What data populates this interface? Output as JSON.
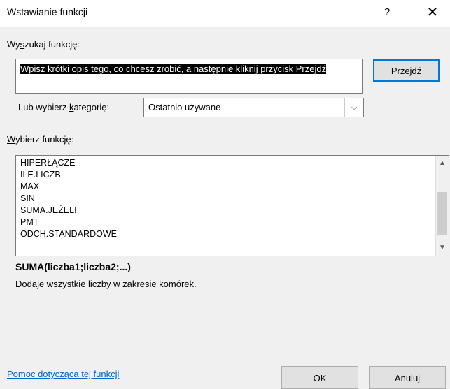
{
  "window": {
    "title": "Wstawianie funkcji",
    "help_glyph": "?",
    "close_glyph": "✕"
  },
  "search": {
    "label_before": "Wy",
    "label_key": "s",
    "label_after": "zukaj funkcję:",
    "value": "Wpisz krótki opis tego, co chcesz zrobić, a następnie kliknij przycisk Przejdź",
    "go_button_key": "P",
    "go_button_rest": "rzejdź"
  },
  "category": {
    "label_before": "Lub wybierz ",
    "label_key": "k",
    "label_after": "ategorię:",
    "selected": "Ostatnio używane"
  },
  "functions": {
    "label_key": "W",
    "label_rest": "ybierz funkcję:",
    "items": [
      "HIPERŁĄCZE",
      "ILE.LICZB",
      "MAX",
      "SIN",
      "SUMA.JEŻELI",
      "PMT",
      "ODCH.STANDARDOWE"
    ]
  },
  "details": {
    "signature": "SUMA(liczba1;liczba2;...)",
    "description": "Dodaje wszystkie liczby w zakresie komórek."
  },
  "footer": {
    "help_link": "Pomoc dotycząca tej funkcji",
    "ok_label": "OK",
    "cancel_label": "Anuluj"
  },
  "colors": {
    "dialog_bg": "#f0f0f0",
    "link": "#0066cc",
    "focus_border": "#0078d7"
  }
}
